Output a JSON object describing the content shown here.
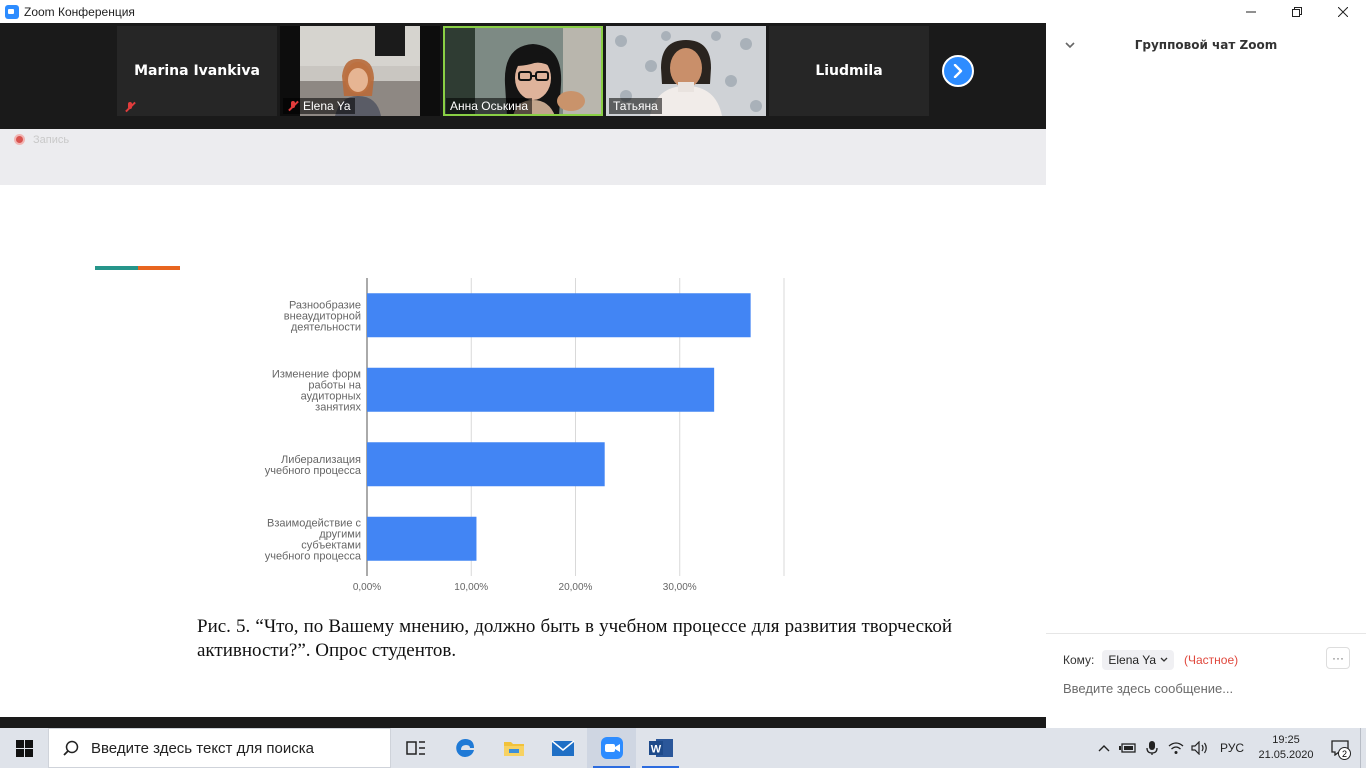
{
  "window": {
    "title": "Zoom Конференция",
    "controls": [
      "minimize-icon",
      "restore-icon",
      "close-icon"
    ]
  },
  "video_strip": {
    "participants": [
      {
        "name": "Marina Ivankiva",
        "video": false,
        "muted": true,
        "active_speaker": false
      },
      {
        "name": "Elena Ya",
        "video": true,
        "muted": true,
        "active_speaker": false
      },
      {
        "name": "Анна Оськина",
        "video": true,
        "muted": false,
        "active_speaker": true
      },
      {
        "name": "Татьяна",
        "video": true,
        "muted": false,
        "active_speaker": false
      },
      {
        "name": "Liudmila",
        "video": false,
        "muted": false,
        "active_speaker": false
      }
    ],
    "next_page_icon": "chevron-right-icon"
  },
  "recording": {
    "label": "Запись",
    "color": "#d9534f"
  },
  "document": {
    "accent_colors": [
      "#26958a",
      "#e8651f"
    ],
    "caption": "Рис. 5.  “Что, по Вашему мнению, должно быть в учебном процессе для развития творческой активности?”. Опрос студентов."
  },
  "chart_data": {
    "type": "bar",
    "orientation": "horizontal",
    "categories": [
      [
        "Разнообразие",
        "внеаудиторной",
        "деятельности"
      ],
      [
        "Изменение форм",
        "работы на",
        "аудиторных",
        "занятиях"
      ],
      [
        "Либерализация",
        "учебного процесса"
      ],
      [
        "Взаимодействие с",
        "другими",
        "субъектами",
        "учебного процесса"
      ]
    ],
    "values": [
      36.8,
      33.3,
      22.8,
      10.5
    ],
    "xlim": [
      0,
      40
    ],
    "xticks": [
      0,
      10,
      20,
      30
    ],
    "xtick_labels": [
      "0,00%",
      "10,00%",
      "20,00%",
      "30,00%"
    ],
    "bar_color": "#4285f4",
    "grid": true
  },
  "chat": {
    "title": "Групповой чат Zoom",
    "to_label": "Кому:",
    "recipient": "Elena Ya",
    "private_label": "(Частное)",
    "more_label": "···",
    "input_placeholder": "Введите здесь сообщение..."
  },
  "taskbar": {
    "search_placeholder": "Введите здесь текст для поиска",
    "apps": [
      "task-view-icon",
      "edge-icon",
      "file-explorer-icon",
      "mail-icon",
      "zoom-icon",
      "word-icon"
    ],
    "language": "РУС",
    "time": "19:25",
    "date": "21.05.2020",
    "notification_count": "2"
  }
}
